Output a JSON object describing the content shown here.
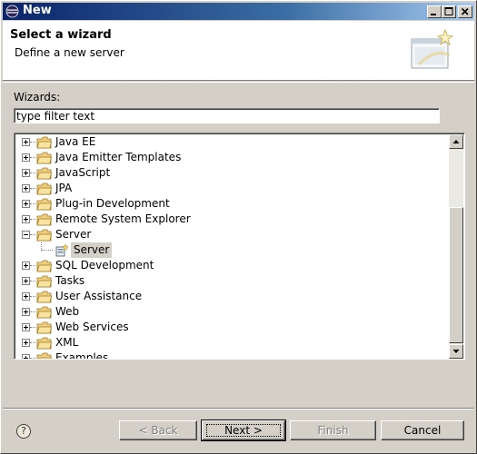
{
  "window": {
    "title": "New"
  },
  "header": {
    "title": "Select a wizard",
    "description": "Define a new server"
  },
  "wizards_label": "Wizards:",
  "filter": {
    "value": "type filter text"
  },
  "tree": {
    "items": [
      {
        "label": "Java EE",
        "expanded": false
      },
      {
        "label": "Java Emitter Templates",
        "expanded": false
      },
      {
        "label": "JavaScript",
        "expanded": false
      },
      {
        "label": "JPA",
        "expanded": false
      },
      {
        "label": "Plug-in Development",
        "expanded": false
      },
      {
        "label": "Remote System Explorer",
        "expanded": false
      },
      {
        "label": "Server",
        "expanded": true
      },
      {
        "label": "Server",
        "child": true,
        "selected": true
      },
      {
        "label": "SQL Development",
        "expanded": false
      },
      {
        "label": "Tasks",
        "expanded": false
      },
      {
        "label": "User Assistance",
        "expanded": false
      },
      {
        "label": "Web",
        "expanded": false
      },
      {
        "label": "Web Services",
        "expanded": false
      },
      {
        "label": "XML",
        "expanded": false
      },
      {
        "label": "Examples",
        "expanded": false
      }
    ]
  },
  "buttons": {
    "back": "< Back",
    "next": "Next >",
    "finish": "Finish",
    "cancel": "Cancel",
    "help": "?"
  },
  "colors": {
    "title_bar": "#0a246a",
    "dialog_bg": "#d4d0c8",
    "selection_bg": "#d4d0c8",
    "folder": "#e8c060"
  },
  "icons": {
    "title": "eclipse-icon",
    "folder": "folder-icon",
    "server": "server-wizard-icon",
    "header_art": "wizard-banner-icon",
    "help": "help-icon"
  }
}
